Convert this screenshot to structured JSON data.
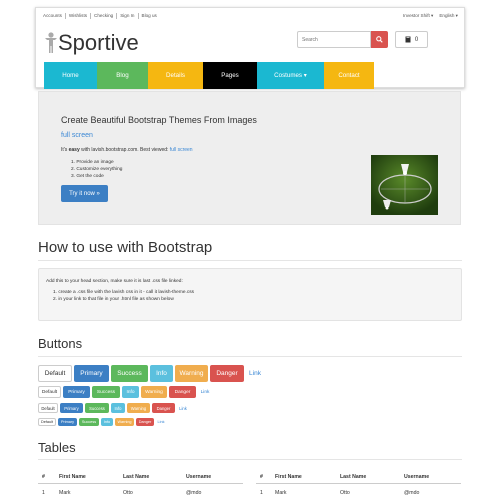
{
  "topbar": {
    "links": [
      "Accounts",
      "Wishlists",
      "Checking",
      "Sign In",
      "Blog us"
    ],
    "right": [
      "Investor Shift ▾",
      "English ▾"
    ]
  },
  "brand": {
    "name": "Sportive"
  },
  "search": {
    "placeholder": "Search"
  },
  "cart": {
    "count": "0"
  },
  "nav": [
    {
      "label": "Home",
      "color": "#1bb8d1"
    },
    {
      "label": "Blog",
      "color": "#5cb85c"
    },
    {
      "label": "Details",
      "color": "#f5b711"
    },
    {
      "label": "Pages",
      "color": "#000000"
    },
    {
      "label": "Costumes ▾",
      "color": "#1bb8d1"
    },
    {
      "label": "Contact",
      "color": "#f5b711"
    }
  ],
  "jumbotron": {
    "title": "Create Beautiful Bootstrap Themes From Images",
    "fullscreen": "full screen",
    "lead_prefix": "It's ",
    "lead_bold": "easy",
    "lead_mid": " with lavish.bootstrap.com. Best viewed: ",
    "lead_link": "full screen",
    "steps": [
      "Provide an image",
      "Customize everything",
      "Get the code"
    ],
    "button": "Try it now »"
  },
  "howto": {
    "title": "How to use with Bootstrap",
    "intro": "Add this to your head section, make sure it is last .css file linked:",
    "steps": [
      "create a .css file with the lavish css in it - call it lavish-theme.css",
      "in your link to that file in your .html file as shown below"
    ]
  },
  "buttons": {
    "title": "Buttons",
    "labels": [
      "Default",
      "Primary",
      "Success",
      "Info",
      "Warning",
      "Danger",
      "Link"
    ],
    "colors": [
      "#ffffff",
      "#3c7fc4",
      "#5cb85c",
      "#5bc0de",
      "#f0ad4e",
      "#d9534f",
      ""
    ]
  },
  "tables": {
    "title": "Tables",
    "headers": [
      "#",
      "First Name",
      "Last Name",
      "Username"
    ],
    "row": [
      "1",
      "Mark",
      "Otto",
      "@mdo"
    ]
  }
}
